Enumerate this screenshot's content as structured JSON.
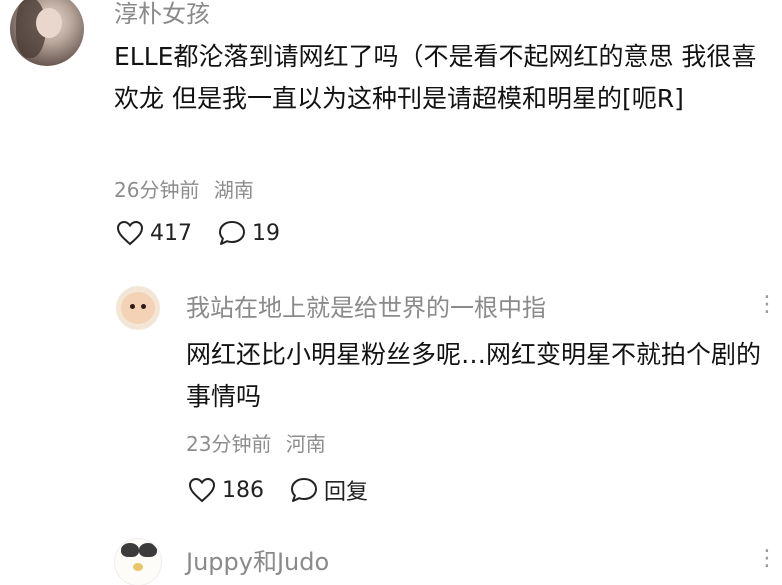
{
  "comment": {
    "username": "淳朴女孩",
    "text": "ELLE都沦落到请网红了吗（不是看不起网红的意思 我很喜欢龙 但是我一直以为这种刊是请超模和明星的[呃R]",
    "time": "26分钟前",
    "location": "湖南",
    "likes": "417",
    "comments": "19"
  },
  "reply1": {
    "username": "我站在地上就是给世界的一根中指",
    "text": "网红还比小明星粉丝多呢…网红变明星不就拍个剧的事情吗",
    "time": "23分钟前",
    "location": "河南",
    "likes": "186",
    "reply_label": "回复",
    "more": "⋮⋮"
  },
  "reply2": {
    "username": "Juppy和Judo",
    "more": "⋮⋮"
  }
}
